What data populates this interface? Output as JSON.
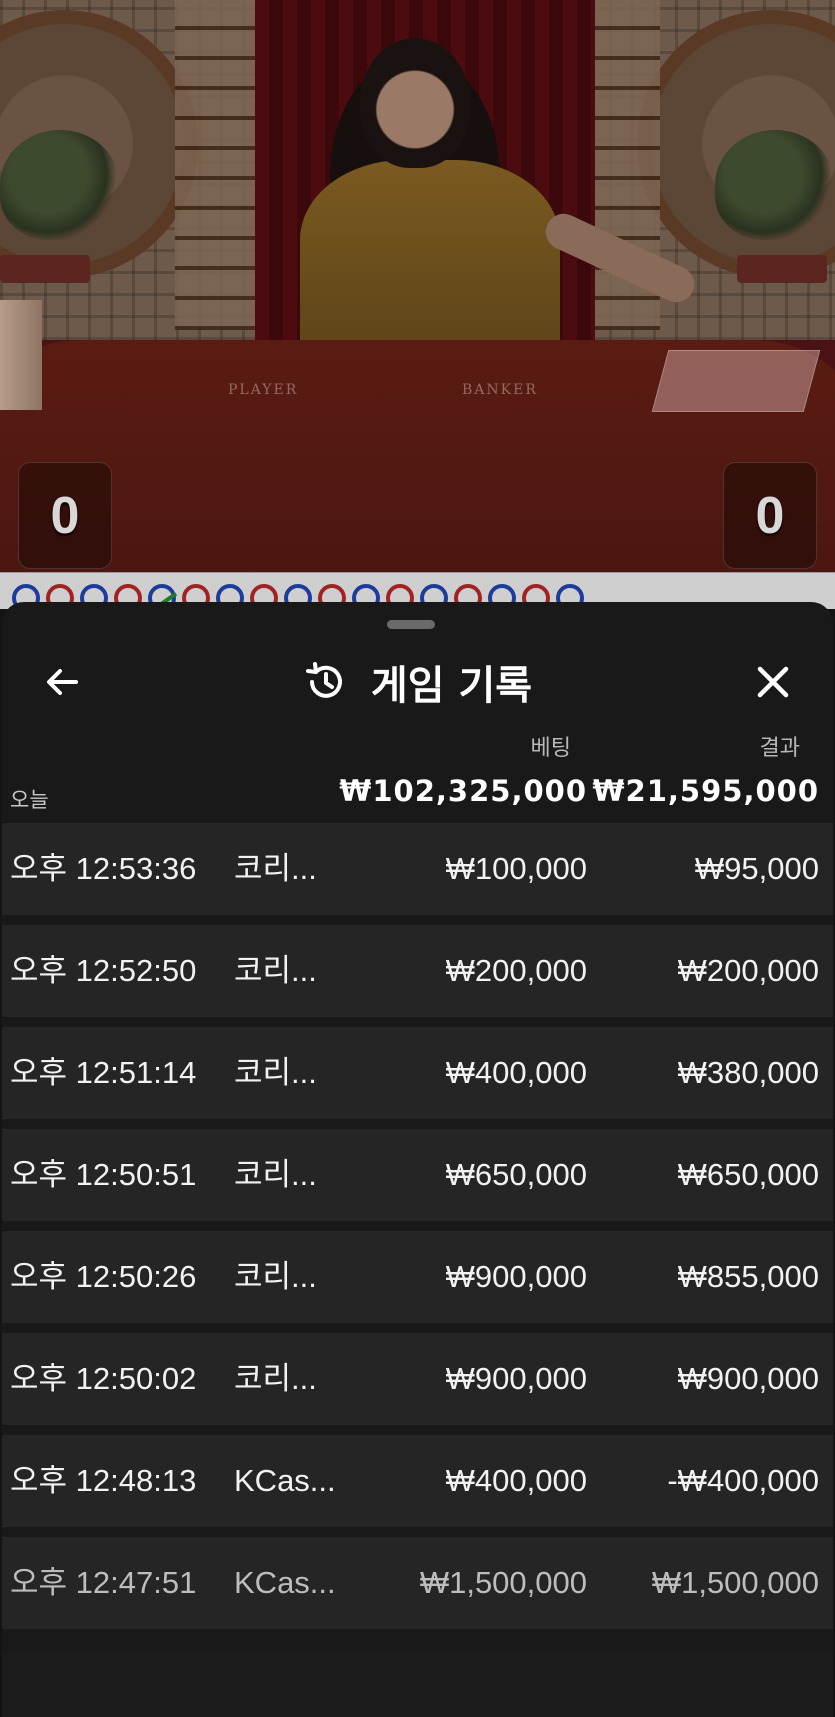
{
  "video": {
    "table_labels": {
      "player": "PLAYER",
      "banker": "BANKER"
    },
    "scores": {
      "player": "0",
      "banker": "0"
    }
  },
  "roadmap": {
    "beads": [
      "player",
      "banker",
      "player",
      "banker",
      "tie",
      "banker",
      "player",
      "banker",
      "player",
      "banker",
      "player",
      "banker",
      "player",
      "banker",
      "player",
      "banker",
      "player"
    ]
  },
  "panel": {
    "title": "게임 기록",
    "icons": {
      "back": "arrow-left-icon",
      "title": "history-icon",
      "close": "close-icon"
    },
    "columns": {
      "bet": "베팅",
      "result": "결과"
    },
    "summary": {
      "label": "오늘",
      "bet_total": "₩102,325,000",
      "result_total": "₩21,595,000"
    },
    "rows": [
      {
        "time": "오후 12:53:36",
        "game": "코리...",
        "bet": "₩100,000",
        "result": "₩95,000"
      },
      {
        "time": "오후 12:52:50",
        "game": "코리...",
        "bet": "₩200,000",
        "result": "₩200,000"
      },
      {
        "time": "오후 12:51:14",
        "game": "코리...",
        "bet": "₩400,000",
        "result": "₩380,000"
      },
      {
        "time": "오후 12:50:51",
        "game": "코리...",
        "bet": "₩650,000",
        "result": "₩650,000"
      },
      {
        "time": "오후 12:50:26",
        "game": "코리...",
        "bet": "₩900,000",
        "result": "₩855,000"
      },
      {
        "time": "오후 12:50:02",
        "game": "코리...",
        "bet": "₩900,000",
        "result": "₩900,000"
      },
      {
        "time": "오후 12:48:13",
        "game": "KCas...",
        "bet": "₩400,000",
        "result": "-₩400,000"
      },
      {
        "time": "오후 12:47:51",
        "game": "KCas...",
        "bet": "₩1,500,000",
        "result": "₩1,500,000"
      }
    ]
  }
}
